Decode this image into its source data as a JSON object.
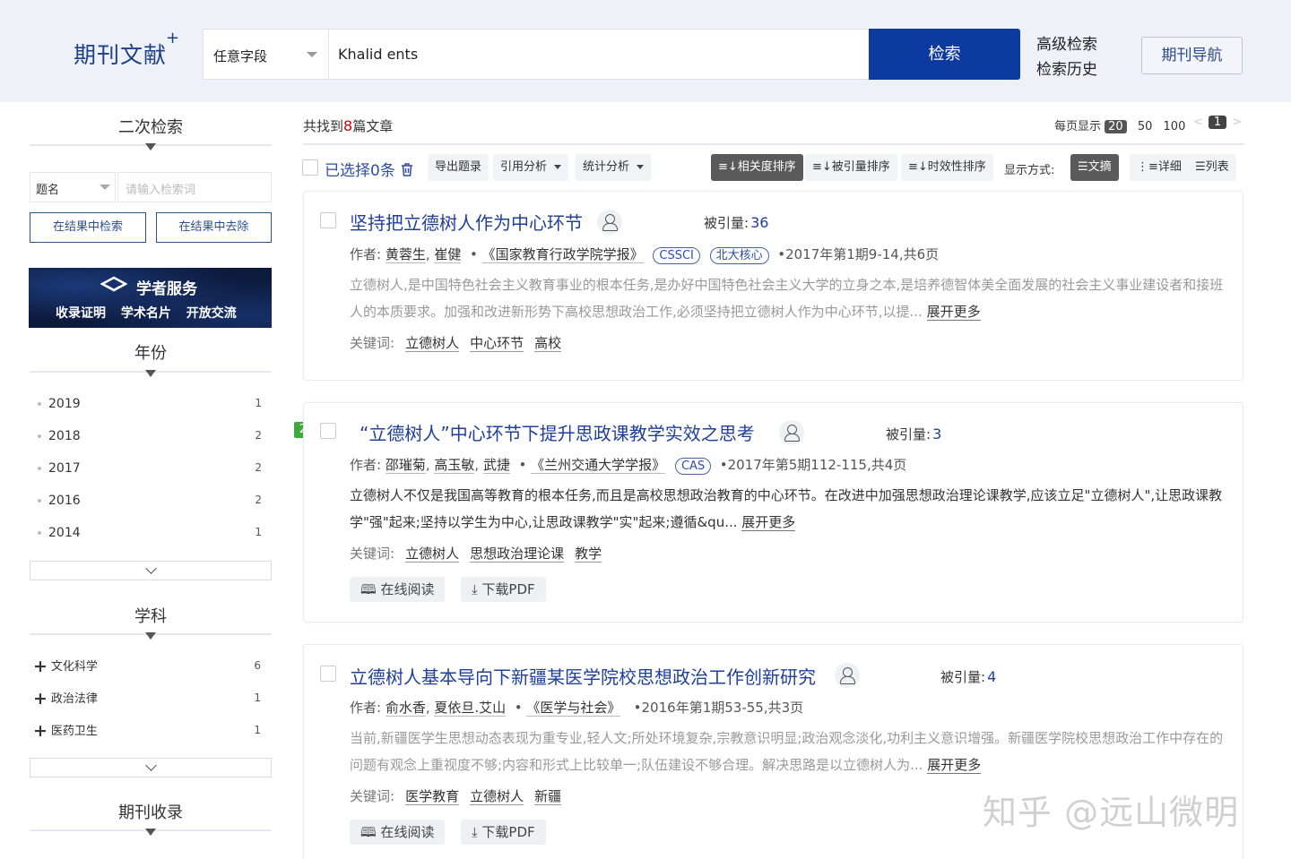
{
  "header": {
    "logo": "期刊文献",
    "logo_sup": "+",
    "field": "任意字段",
    "query": "Khalid ents",
    "search_button": "检索",
    "advanced": "高级检索",
    "history": "检索历史",
    "journal_nav": "期刊导航"
  },
  "sidebar": {
    "secondary_title": "二次检索",
    "field_select": "题名",
    "input_placeholder": "请输入检索词",
    "btn_in_results": "在结果中检索",
    "btn_exclude": "在结果中去除",
    "banner_title": "学者服务",
    "banner_sub": "收录证明 学术名片 开放交流",
    "year_title": "年份",
    "years": [
      {
        "label": "2019",
        "count": "1"
      },
      {
        "label": "2018",
        "count": "2"
      },
      {
        "label": "2017",
        "count": "2"
      },
      {
        "label": "2016",
        "count": "2"
      },
      {
        "label": "2014",
        "count": "1"
      }
    ],
    "subject_title": "学科",
    "subjects": [
      {
        "label": "文化科学",
        "count": "6"
      },
      {
        "label": "政治法律",
        "count": "1"
      },
      {
        "label": "医药卫生",
        "count": "1"
      }
    ],
    "journal_title": "期刊收录"
  },
  "results": {
    "count_prefix": "共找到",
    "count": "8",
    "count_suffix": "篇文章",
    "per_page_label": "每页显示",
    "per_page_active": "20",
    "per_page_options": [
      "50",
      "100"
    ],
    "page_prev": "<",
    "page_current": "1",
    "page_next": ">"
  },
  "toolbar": {
    "selected": "已选择0条",
    "export": "导出题录",
    "citation": "引用分析",
    "stats": "统计分析",
    "sort_relevance": "相关度排序",
    "sort_cited": "被引量排序",
    "sort_time": "时效性排序",
    "display_label": "显示方式:",
    "view_abstract": "文摘",
    "view_detail": "详细",
    "view_list": "列表"
  },
  "articles": [
    {
      "title": "坚持把立德树人作为中心环节",
      "cite_label": "被引量:",
      "cite_value": "36",
      "author_label": "作者:",
      "authors": [
        "黄蓉生",
        "崔健"
      ],
      "journal": "《国家教育行政学院学报》",
      "tags": [
        "CSSCI",
        "北大核心"
      ],
      "issue": "2017年第1期9-14,共6页",
      "abstract": "立德树人,是中国特色社会主义教育事业的根本任务,是办好中国特色社会主义大学的立身之本,是培养德智体美全面发展的社会主义事业建设者和接班人的本质要求。加强和改进新形势下高校思想政治工作,必须坚持把立德树人作为中心环节,以提...",
      "more": "展开更多",
      "kw_label": "关键词:",
      "keywords": [
        "立德树人",
        "中心环节",
        "高校"
      ]
    },
    {
      "number": "2",
      "title": "“立德树人”中心环节下提升思政课教学实效之思考",
      "cite_label": "被引量:",
      "cite_value": "3",
      "author_label": "作者:",
      "authors": [
        "邵璀菊",
        "高玉敏",
        "武捷"
      ],
      "journal": "《兰州交通大学学报》",
      "tags": [
        "CAS"
      ],
      "issue": "2017年第5期112-115,共4页",
      "abstract": "立德树人不仅是我国高等教育的根本任务,而且是高校思想政治教育的中心环节。在改进中加强思想政治理论课教学,应该立足\"立德树人\",让思政课教学\"强\"起来;坚持以学生为中心,让思政课教学\"实\"起来;遵循&qu...",
      "more": "展开更多",
      "kw_label": "关键词:",
      "keywords": [
        "立德树人",
        "思想政治理论课",
        "教学"
      ],
      "read_online": "在线阅读",
      "download": "下载PDF"
    },
    {
      "title": "立德树人基本导向下新疆某医学院校思想政治工作创新研究",
      "cite_label": "被引量:",
      "cite_value": "4",
      "author_label": "作者:",
      "authors": [
        "俞水香",
        "夏依旦.艾山"
      ],
      "journal": "《医学与社会》",
      "tags": [],
      "issue": "2016年第1期53-55,共3页",
      "abstract": "当前,新疆医学生思想动态表现为重专业,轻人文;所处环境复杂,宗教意识明显;政治观念淡化,功利主义意识增强。新疆医学院校思想政治工作中存在的问题有观念上重视度不够;内容和形式上比较单一;队伍建设不够合理。解决思路是以立德树人为...",
      "more": "展开更多",
      "kw_label": "关键词:",
      "keywords": [
        "医学教育",
        "立德树人",
        "新疆"
      ],
      "read_online": "在线阅读",
      "download": "下载PDF"
    }
  ],
  "watermark": "知乎 @远山微明"
}
